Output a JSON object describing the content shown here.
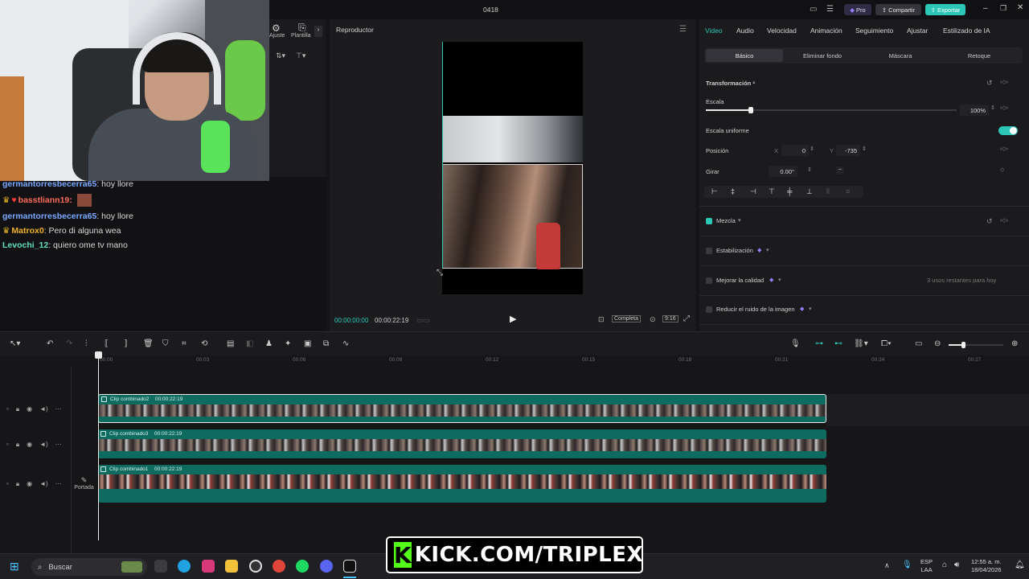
{
  "window": {
    "title": "0418",
    "pro_label": "Pro",
    "share_label": "Compartir",
    "export_label": "Exportar"
  },
  "chat": [
    {
      "user": "germantorresbecerra65",
      "message": ": hoy llore",
      "color": "#7aa9ff",
      "crown": false
    },
    {
      "user": "basstliann19:",
      "message": "",
      "color": "#ff6b5a",
      "crown": true
    },
    {
      "user": "germantorresbecerra65",
      "message": ": hoy llore",
      "color": "#7aa9ff",
      "crown": false
    },
    {
      "user": "Matrox0",
      "message": ": Pero di alguna wea",
      "color": "#f0b12a",
      "crown": true
    },
    {
      "user": "Levochi_12",
      "message": ": quiero ome tv mano",
      "color": "#5fe0c0",
      "crown": false
    }
  ],
  "left_panel": {
    "tools": [
      {
        "label": "Ajuste",
        "icon": "sliders-icon"
      },
      {
        "label": "Plantilla",
        "icon": "template-icon"
      }
    ]
  },
  "player": {
    "title": "Reproductor",
    "current_time": "00:00:00:00",
    "total_time": "00:00:22:19",
    "quality_label": "Completa",
    "ratio_label": "9:16"
  },
  "inspector": {
    "tabs": [
      "Video",
      "Audio",
      "Velocidad",
      "Animación",
      "Seguimiento",
      "Ajustar",
      "Estilizado de IA"
    ],
    "active_tab": "Video",
    "subtabs": [
      "Básico",
      "Eliminar fondo",
      "Máscara",
      "Retoque"
    ],
    "active_subtab": "Básico",
    "transform_label": "Transformación",
    "scale_label": "Escala",
    "scale_value": "100%",
    "scale_fraction": 0.18,
    "uniform_label": "Escala uniforme",
    "position_label": "Posición",
    "pos_x_label": "X",
    "pos_x_value": "0",
    "pos_y_label": "Y",
    "pos_y_value": "-735",
    "rotate_label": "Girar",
    "rotate_value": "0.00°",
    "blend_label": "Mezcla",
    "stabilization_label": "Estabilización",
    "quality_label": "Mejorar la calidad",
    "quality_note": "3 usos restantes para hoy",
    "noise_label": "Reducir el ruido de la imagen",
    "accent": "#2cc6b7"
  },
  "timeline": {
    "ruler": [
      "00:00",
      "00:03",
      "00:06",
      "00:09",
      "00:12",
      "00:15",
      "00:18",
      "00:21",
      "00:24",
      "00:27"
    ],
    "clips": [
      {
        "label": "Clip combinado2",
        "duration": "00:00:22:19"
      },
      {
        "label": "Clip combinado3",
        "duration": "00:00:22:19"
      },
      {
        "label": "Clip combinado1",
        "duration": "00:00:22:19"
      }
    ],
    "cover_label": "Portada"
  },
  "overlay": {
    "kick_letter": "K",
    "kick_text": "KICK.COM/TRIPLEX"
  },
  "taskbar": {
    "search_placeholder": "Buscar",
    "lang_top": "ESP",
    "lang_bottom": "LAA",
    "time": "12:55 a. m.",
    "date": "18/04/2026"
  }
}
